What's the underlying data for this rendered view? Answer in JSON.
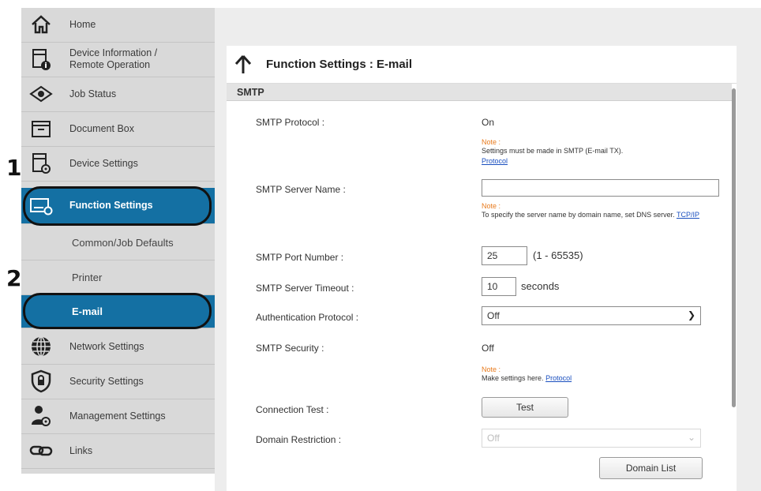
{
  "callouts": [
    "1",
    "2"
  ],
  "sidebar": {
    "items": [
      {
        "label": "Home",
        "icon": "home-icon"
      },
      {
        "label": "Device Information /",
        "label2": "Remote Operation",
        "icon": "device-info-icon"
      },
      {
        "label": "Job Status",
        "icon": "eye-icon"
      },
      {
        "label": "Document Box",
        "icon": "document-box-icon"
      },
      {
        "label": "Device Settings",
        "icon": "device-settings-icon"
      },
      {
        "label": "Function Settings",
        "icon": "function-settings-icon"
      },
      {
        "label": "Common/Job Defaults"
      },
      {
        "label": "Printer"
      },
      {
        "label": "E-mail"
      },
      {
        "label": "Network Settings",
        "icon": "globe-icon"
      },
      {
        "label": "Security Settings",
        "icon": "shield-icon"
      },
      {
        "label": "Management Settings",
        "icon": "management-icon"
      },
      {
        "label": "Links",
        "icon": "link-icon"
      }
    ],
    "active_color": "#1470a3"
  },
  "page": {
    "title": "Function Settings : E-mail",
    "section": "SMTP"
  },
  "form": {
    "smtp_protocol": {
      "label": "SMTP Protocol :",
      "value": "On"
    },
    "note_label": "Note :",
    "note1_text": "Settings must be made in SMTP (E-mail TX).",
    "note1_link": "Protocol",
    "smtp_server_name": {
      "label": "SMTP Server Name :",
      "value": ""
    },
    "note2_text": "To specify the server name by domain name, set DNS server.",
    "note2_link": "TCP/IP",
    "smtp_port": {
      "label": "SMTP Port Number :",
      "value": "25",
      "range": "(1 - 65535)"
    },
    "smtp_timeout": {
      "label": "SMTP Server Timeout :",
      "value": "10",
      "unit": "seconds"
    },
    "auth_protocol": {
      "label": "Authentication Protocol :",
      "value": "Off"
    },
    "smtp_security": {
      "label": "SMTP Security :",
      "value": "Off"
    },
    "note3_text": "Make settings here.",
    "note3_link": "Protocol",
    "connection_test": {
      "label": "Connection Test :",
      "button": "Test"
    },
    "domain_restriction": {
      "label": "Domain Restriction :",
      "value": "Off",
      "button": "Domain List"
    }
  }
}
